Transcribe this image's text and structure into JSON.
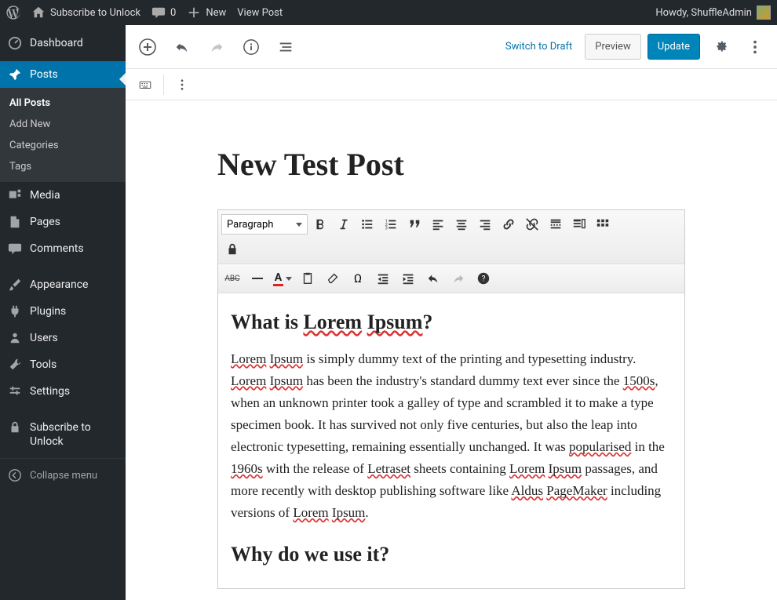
{
  "adminbar": {
    "site_name": "Subscribe to Unlock",
    "comments_count": "0",
    "new_label": "New",
    "view_post": "View Post",
    "howdy": "Howdy, ShuffleAdmin"
  },
  "sidebar": {
    "dashboard": "Dashboard",
    "posts": "Posts",
    "posts_sub": {
      "all": "All Posts",
      "add": "Add New",
      "categories": "Categories",
      "tags": "Tags"
    },
    "media": "Media",
    "pages": "Pages",
    "comments": "Comments",
    "appearance": "Appearance",
    "plugins": "Plugins",
    "users": "Users",
    "tools": "Tools",
    "settings": "Settings",
    "subscribe": "Subscribe to Unlock",
    "collapse": "Collapse menu"
  },
  "editor": {
    "switch_to_draft": "Switch to Draft",
    "preview": "Preview",
    "update": "Update",
    "format_dropdown": "Paragraph",
    "post_title": "New Test Post",
    "content": {
      "h1_prefix": "What is ",
      "h1_w1": "Lorem",
      "h1_w2": "Ipsum",
      "h1_suffix": "?",
      "p1_w1": "Lorem",
      "p1_w2": "Ipsum",
      "p1_t1": " is simply dummy text of the printing and typesetting industry. ",
      "p1_w3": "Lorem",
      "p1_w4": "Ipsum",
      "p1_t2": " has been the industry's standard dummy text ever since the ",
      "p1_w5": "1500s",
      "p1_t3": ", when an unknown printer took a galley of type and scrambled it to make a type specimen book. It has survived not only five centuries, but also the leap into electronic typesetting, remaining essentially unchanged. It was ",
      "p1_w6": "popularised",
      "p1_t4": " in the ",
      "p1_w7": "1960s",
      "p1_t5": " with the release of ",
      "p1_w8": "Letraset",
      "p1_t6": " sheets containing ",
      "p1_w9": "Lorem",
      "p1_w10": "Ipsum",
      "p1_t7": " passages, and more recently with desktop publishing software like ",
      "p1_w11": "Aldus",
      "p1_w12": "PageMaker",
      "p1_t8": " including versions of ",
      "p1_w13": "Lorem",
      "p1_w14": "Ipsum",
      "p1_t9": ".",
      "h2_prefix": "Why do we use it?"
    }
  }
}
